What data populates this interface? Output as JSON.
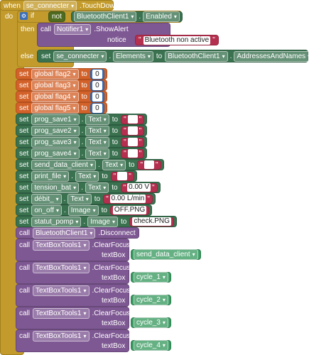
{
  "event": {
    "when": "when",
    "component": "se_connecter",
    "event_name": ".TouchDown",
    "do": "do"
  },
  "if_block": {
    "if_label": "if",
    "not_label": "not",
    "condition_component": "BluetoothClient1",
    "condition_property": "Enabled",
    "then_label": "then",
    "else_label": "else",
    "call_label": "call",
    "notifier": "Notifier1",
    "notifier_method": ".ShowAlert",
    "notice_label": "notice",
    "notice_text": "Bluetooth non active",
    "else_set": {
      "set_label": "set",
      "component": "se_connecter",
      "property": "Elements",
      "to_label": "to",
      "value_component": "BluetoothClient1",
      "value_property": "AddressesAndNames"
    }
  },
  "globals": [
    {
      "set": "set",
      "name": "global flag2",
      "to": "to",
      "value": "0"
    },
    {
      "set": "set",
      "name": "global flag3",
      "to": "to",
      "value": "0"
    },
    {
      "set": "set",
      "name": "global flag4",
      "to": "to",
      "value": "0"
    },
    {
      "set": "set",
      "name": "global flag5",
      "to": "to",
      "value": "0"
    }
  ],
  "text_sets": [
    {
      "set": "set",
      "component": "prog_save1",
      "property": "Text",
      "to": "to",
      "value": " "
    },
    {
      "set": "set",
      "component": "prog_save2",
      "property": "Text",
      "to": "to",
      "value": " "
    },
    {
      "set": "set",
      "component": "prog_save3",
      "property": "Text",
      "to": "to",
      "value": " "
    },
    {
      "set": "set",
      "component": "prog_save4",
      "property": "Text",
      "to": "to",
      "value": " "
    },
    {
      "set": "set",
      "component": "send_data_client",
      "property": "Text",
      "to": "to",
      "value": " "
    },
    {
      "set": "set",
      "component": "print_file",
      "property": "Text",
      "to": "to",
      "value": " "
    },
    {
      "set": "set",
      "component": "tension_bat",
      "property": "Text",
      "to": "to",
      "value": "0.00 V"
    },
    {
      "set": "set",
      "component": "débit_",
      "property": "Text",
      "to": "to",
      "value": "0.00 L/min"
    },
    {
      "set": "set",
      "component": "on_off",
      "property": "Image",
      "to": "to",
      "value": "OFF.PNG"
    },
    {
      "set": "set",
      "component": "statut_pomp",
      "property": "Image",
      "to": "to",
      "value": "check.PNG"
    }
  ],
  "disconnect": {
    "call": "call",
    "component": "BluetoothClient1",
    "method": ".Disconnect"
  },
  "clear_focus": [
    {
      "call": "call",
      "component": "TextBoxTools1",
      "method": ".ClearFocus",
      "arg_label": "textBox",
      "arg": "send_data_client"
    },
    {
      "call": "call",
      "component": "TextBoxTools1",
      "method": ".ClearFocus",
      "arg_label": "textBox",
      "arg": "cycle_1"
    },
    {
      "call": "call",
      "component": "TextBoxTools1",
      "method": ".ClearFocus",
      "arg_label": "textBox",
      "arg": "cycle_2"
    },
    {
      "call": "call",
      "component": "TextBoxTools1",
      "method": ".ClearFocus",
      "arg_label": "textBox",
      "arg": "cycle_3"
    },
    {
      "call": "call",
      "component": "TextBoxTools1",
      "method": ".ClearFocus",
      "arg_label": "textBox",
      "arg": "cycle_4"
    }
  ],
  "colors": {
    "event": "#c39b2c",
    "control": "#c39b2c",
    "logic": "#4f6b1f",
    "component_set": "#3a7250",
    "procedure_call": "#7e5893",
    "variable": "#d2622a",
    "math": "#3b6fb8",
    "text": "#b5304f"
  }
}
